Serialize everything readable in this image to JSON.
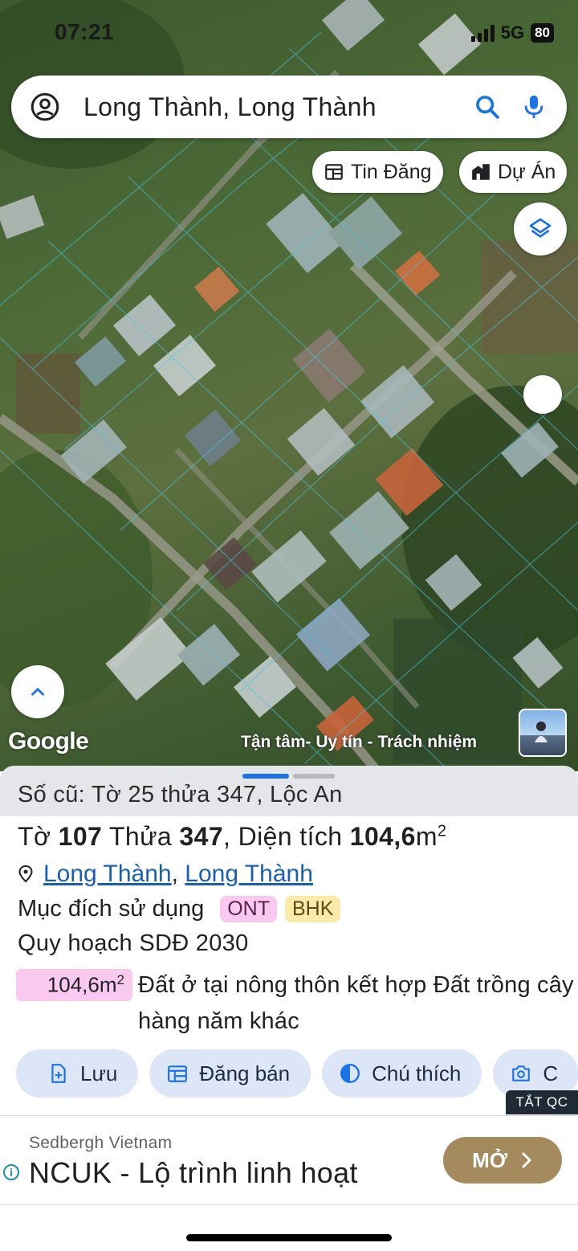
{
  "status_bar": {
    "time": "07:21",
    "network": "5G",
    "battery": "80"
  },
  "search": {
    "text": "Long Thành, Long Thành",
    "account_icon": "account-circle-icon",
    "search_icon": "search-icon",
    "mic_icon": "mic-icon"
  },
  "chips": {
    "listings": "Tin Đăng",
    "projects": "Dự Án"
  },
  "map": {
    "google_label": "Google",
    "watermark": "Tận tâm- Uy tín - Trách nhiệm"
  },
  "sheet": {
    "old_ref": "Số cũ: Tờ 25 thửa 347, Lộc An",
    "title": {
      "sheet_label": "Tờ",
      "sheet_no": "107",
      "parcel_label": "Thửa",
      "parcel_no": "347",
      "area_label": ", Diện tích",
      "area_value": "104,6",
      "area_unit": "m",
      "area_sup": "2"
    },
    "location": {
      "district": "Long Thành",
      "separator": ",",
      "commune": "Long Thành"
    },
    "purpose": {
      "label": "Mục đích sử dụng",
      "tags": [
        "ONT",
        "BHK"
      ]
    },
    "plan": {
      "title": "Quy hoạch SDĐ 2030",
      "area": "104,6m",
      "area_sup": "2",
      "desc": "Đất ở tại nông thôn kết hợp Đất trồng cây hàng năm khác"
    },
    "actions": {
      "save": "Lưu",
      "post": "Đăng bán",
      "legend": "Chú thích",
      "capture": "C"
    }
  },
  "ad": {
    "close_label": "TẮT QC",
    "sponsor": "Sedbergh Vietnam",
    "headline": "NCUK - Lộ trình linh hoạt",
    "cta": "MỞ"
  },
  "colors": {
    "accent": "#1a73e8",
    "tag_ont": "#f9c9ef",
    "tag_bhk": "#fbeaa8",
    "action_bg": "#dde6f7",
    "cta": "#a48a5c"
  }
}
